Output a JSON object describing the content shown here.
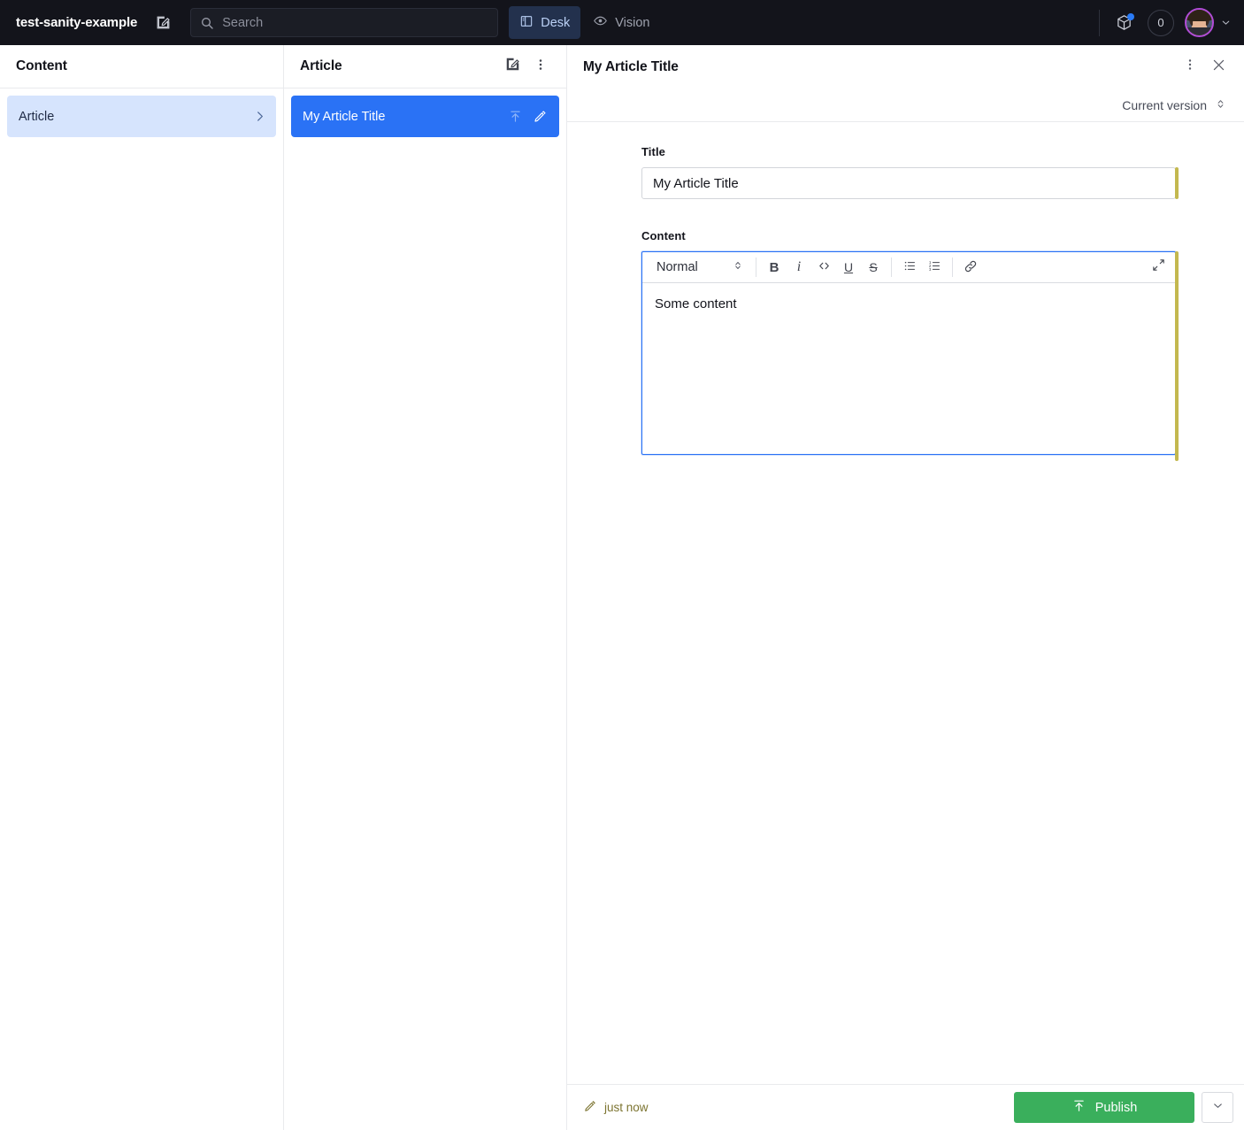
{
  "navbar": {
    "brand": "test-sanity-example",
    "compose_icon": "compose-icon",
    "search": {
      "placeholder": "Search",
      "value": "",
      "icon": "search-icon"
    },
    "tabs": [
      {
        "label": "Desk",
        "icon": "desk-panel-icon",
        "active": true
      },
      {
        "label": "Vision",
        "icon": "eye-icon",
        "active": false
      }
    ],
    "packages_icon": "package-cube-icon",
    "packages_badge": true,
    "presence_count": "0",
    "avatar": "user-avatar",
    "avatar_caret": "chevron-down-icon"
  },
  "content_pane": {
    "title": "Content",
    "items": [
      {
        "label": "Article",
        "selected": true,
        "chevron": "chevron-right-icon"
      }
    ]
  },
  "article_pane": {
    "title": "Article",
    "actions": [
      {
        "name": "create-new-document-button",
        "icon": "compose-icon"
      },
      {
        "name": "pane-menu-button",
        "icon": "ellipsis-vertical-icon"
      }
    ],
    "documents": [
      {
        "title": "My Article Title",
        "selected": true,
        "icons": [
          {
            "name": "publish-status-icon",
            "icon": "arrow-up-to-line-icon"
          },
          {
            "name": "edit-status-icon",
            "icon": "pencil-icon"
          }
        ]
      }
    ]
  },
  "document_pane": {
    "title": "My Article Title",
    "menu_icon": "ellipsis-vertical-icon",
    "close_icon": "close-icon",
    "version": {
      "label": "Current version",
      "icon": "chevron-up-down-icon"
    },
    "fields": {
      "title": {
        "label": "Title",
        "value": "My Article Title",
        "changed": true
      },
      "content": {
        "label": "Content",
        "value": "Some content",
        "changed": true,
        "toolbar": {
          "style": {
            "label": "Normal",
            "icon": "chevron-up-down-icon"
          },
          "buttons": [
            {
              "name": "bold-button",
              "glyph": "B",
              "icon": "bold-icon"
            },
            {
              "name": "italic-button",
              "glyph": "i",
              "icon": "italic-icon"
            },
            {
              "name": "code-button",
              "glyph": "<>",
              "icon": "code-icon"
            },
            {
              "name": "underline-button",
              "glyph": "U",
              "icon": "underline-icon"
            },
            {
              "name": "strikethrough-button",
              "glyph": "S",
              "icon": "strikethrough-icon"
            }
          ],
          "lists": [
            {
              "name": "bulleted-list-button",
              "icon": "bulleted-list-icon"
            },
            {
              "name": "numbered-list-button",
              "icon": "numbered-list-icon"
            }
          ],
          "link": {
            "name": "link-button",
            "icon": "link-icon"
          },
          "expand": {
            "name": "expand-editor-button",
            "icon": "expand-icon"
          }
        }
      }
    },
    "footer": {
      "edited_label": "just now",
      "edited_icon": "pencil-icon",
      "publish_label": "Publish",
      "publish_icon": "arrow-up-to-line-icon",
      "publish_caret": "chevron-down-icon"
    }
  },
  "colors": {
    "navbar_bg": "#13141b",
    "accent_blue": "#2a72f5",
    "selected_item_bg": "#d6e4fd",
    "active_tab_bg": "#23314d",
    "publish_green": "#3aaf5c",
    "change_indicator": "#c3b84f",
    "avatar_ring": "#b14bd8",
    "badge_dot": "#2a7bf6"
  }
}
